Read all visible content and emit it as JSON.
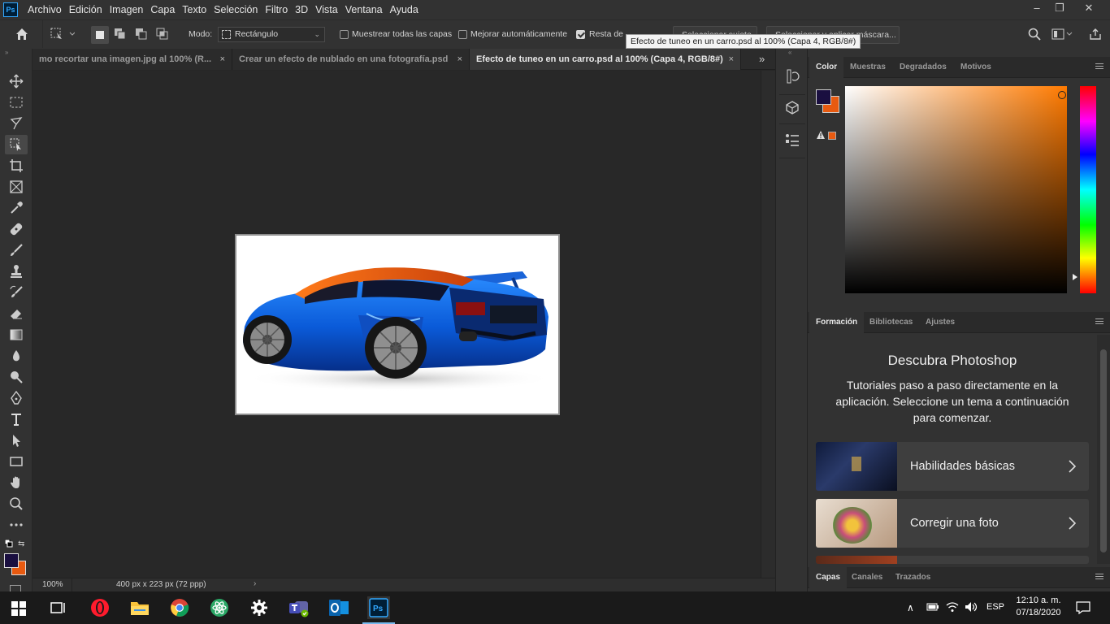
{
  "app": {
    "logo_text": "Ps"
  },
  "menu": [
    "Archivo",
    "Edición",
    "Imagen",
    "Capa",
    "Texto",
    "Selección",
    "Filtro",
    "3D",
    "Vista",
    "Ventana",
    "Ayuda"
  ],
  "options": {
    "mode_label": "Modo:",
    "mode_value": "Rectángulo",
    "sample_all_layers": "Muestrear todas las capas",
    "auto_enhance": "Mejorar automáticamente",
    "subtract_label": "Resta de objeto",
    "select_subject": "Seleccionar sujeto",
    "select_mask": "Seleccionar y aplicar máscara..."
  },
  "tooltip": "Efecto de tuneo en un carro.psd al 100% (Capa 4, RGB/8#)",
  "tabs": [
    {
      "label": "mo recortar una imagen.jpg al 100% (R...",
      "close": "×"
    },
    {
      "label": "Crear un efecto de nublado en una fotografía.psd",
      "close": "×"
    },
    {
      "label": "Efecto de tuneo en un carro.psd al 100% (Capa 4, RGB/8#)",
      "close": "×"
    }
  ],
  "status": {
    "zoom": "100%",
    "doc_size": "400 px x 223 px (72 ppp)"
  },
  "color_panel": {
    "tabs": [
      "Color",
      "Muestras",
      "Degradados",
      "Motivos"
    ],
    "foreground": "#1a0f40",
    "background": "#e85a10",
    "hue_color": "#ff7a00"
  },
  "learn_panel": {
    "tabs": [
      "Formación",
      "Bibliotecas",
      "Ajustes"
    ],
    "title": "Descubra Photoshop",
    "description": "Tutoriales paso a paso directamente en la aplicación. Seleccione un tema a continuación para comenzar.",
    "cards": [
      {
        "label": "Habilidades básicas"
      },
      {
        "label": "Corregir una foto"
      }
    ]
  },
  "layers_panel": {
    "tabs": [
      "Capas",
      "Canales",
      "Trazados"
    ]
  },
  "taskbar": {
    "language": "ESP",
    "time": "12:10 a. m.",
    "date": "07/18/2020"
  }
}
